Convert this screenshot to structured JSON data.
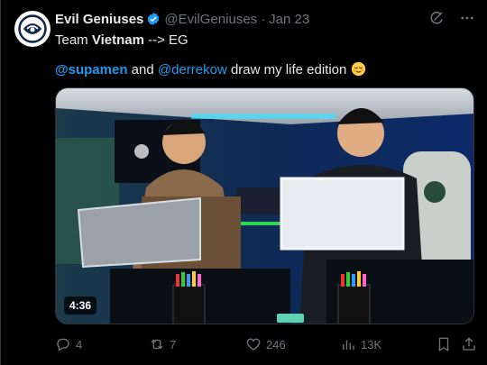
{
  "author": {
    "display_name": "Evil Geniuses",
    "handle": "@EvilGeniuses",
    "separator": "·",
    "time": "Jan 23",
    "avatar_icon": "eg-logo-icon",
    "verified_icon": "verified-badge-icon",
    "verified_color": "#1d9bf0"
  },
  "header_actions": [
    {
      "icon": "grok-icon"
    },
    {
      "icon": "more-icon"
    }
  ],
  "tweet": {
    "line1_prefix": "Team ",
    "line1_bold": "Vietnam",
    "line1_suffix": " --> EG",
    "mention1": "@supamen",
    "and": " and ",
    "mention2": "@derrekow",
    "line2_suffix": " draw my life edition ",
    "emoji": "relieved-face-emoji",
    "mention_color": "#1d9bf0"
  },
  "media": {
    "type": "video",
    "duration": "4:36"
  },
  "actions": {
    "replies": "4",
    "reposts": "7",
    "likes": "246",
    "views": "13K",
    "reply_icon": "reply-icon",
    "repost_icon": "repost-icon",
    "like_icon": "heart-icon",
    "views_icon": "views-icon",
    "bookmark_icon": "bookmark-icon",
    "share_icon": "share-icon"
  }
}
